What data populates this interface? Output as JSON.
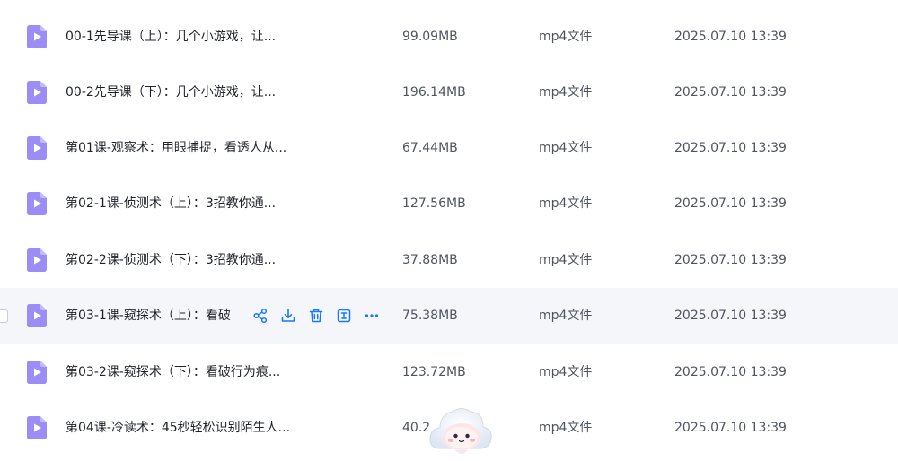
{
  "files": [
    {
      "name": "00-1先导课（上）：几个小游戏，让...",
      "size": "99.09MB",
      "type": "mp4文件",
      "time": "2025.07.10 13:39",
      "icon": "video-file-icon"
    },
    {
      "name": "00-2先导课（下）：几个小游戏，让...",
      "size": "196.14MB",
      "type": "mp4文件",
      "time": "2025.07.10 13:39",
      "icon": "video-file-icon"
    },
    {
      "name": "第01课-观察术：用眼捕捉，看透人从...",
      "size": "67.44MB",
      "type": "mp4文件",
      "time": "2025.07.10 13:39",
      "icon": "video-file-icon"
    },
    {
      "name": "第02-1课-侦测术（上）：3招教你通...",
      "size": "127.56MB",
      "type": "mp4文件",
      "time": "2025.07.10 13:39",
      "icon": "video-file-icon"
    },
    {
      "name": "第02-2课-侦测术（下）：3招教你通...",
      "size": "37.88MB",
      "type": "mp4文件",
      "time": "2025.07.10 13:39",
      "icon": "video-file-icon"
    },
    {
      "name": "第03-1课-窥探术（上）：看破",
      "size": "75.38MB",
      "type": "mp4文件",
      "time": "2025.07.10 13:39",
      "icon": "video-file-icon",
      "hovered": true
    },
    {
      "name": "第03-2课-窥探术（下）：看破行为痕...",
      "size": "123.72MB",
      "type": "mp4文件",
      "time": "2025.07.10 13:39",
      "icon": "video-file-icon"
    },
    {
      "name": "第04课-冷读术：45秒轻松识别陌生人...",
      "size": "40.2",
      "type": "mp4文件",
      "time": "2025.07.10 13:39",
      "icon": "video-file-icon"
    }
  ],
  "row_actions": [
    "share-icon",
    "download-icon",
    "delete-icon",
    "rename-icon",
    "more-icon"
  ],
  "colors": {
    "accent": "#1677ff",
    "file_icon": "#9b8cf6",
    "hover_row": "#f5f6fa",
    "text_primary": "#1f2329",
    "text_secondary": "#4e5463"
  }
}
